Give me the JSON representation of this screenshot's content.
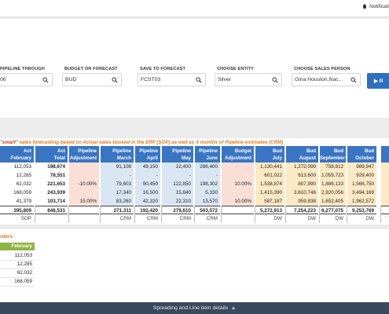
{
  "topbar": {
    "notifications_label": "Notificati"
  },
  "filters": {
    "pipeline_label": "PIPELINE THROUGH",
    "pipeline_value": "06",
    "budget_label": "BUDGET OR FORECAST",
    "budget_value": "BUD",
    "save_label": "SAVE TO FORECAST",
    "save_value": "FCST03",
    "entity_label": "CHOOSE ENTITY",
    "entity_value": "Silver",
    "person_label": "CHOOSE SALES PERSON",
    "person_value": "Gina Houston,Nac...",
    "run_label": "▶ R"
  },
  "section_title": {
    "smart": "\"smart\"",
    "rest": "sales forecasting based on Actual sales booked in the ERP (SOP) as well as X months of Pipeline estimates (CRM)"
  },
  "columns": [
    {
      "h1": "Act",
      "h2": "February"
    },
    {
      "h1": "Act",
      "h2": "Total"
    },
    {
      "h1": "Pipeline",
      "h2": "Adjustment"
    },
    {
      "h1": "Pipeline",
      "h2": "March"
    },
    {
      "h1": "Pipeline",
      "h2": "April"
    },
    {
      "h1": "Pipeline",
      "h2": "May"
    },
    {
      "h1": "Pipeline",
      "h2": "June"
    },
    {
      "h1": "Budget",
      "h2": "Adjustment"
    },
    {
      "h1": "Bud",
      "h2": "July"
    },
    {
      "h1": "Bud",
      "h2": "August"
    },
    {
      "h1": "Bud",
      "h2": "September"
    },
    {
      "h1": "Bud",
      "h2": "October"
    },
    {
      "h1": "No",
      "h2": ""
    }
  ],
  "rows": [
    [
      "112,053",
      "198,674",
      "",
      "91,108",
      "49,150",
      "22,400",
      "286,400",
      "",
      "1,130,441",
      "1,272,099",
      "758,812",
      "989,947",
      "1,4"
    ],
    [
      "12,285",
      "78,551",
      "",
      "-",
      "-",
      "-",
      "-",
      "",
      "601,022",
      "613,600",
      "1,059,723",
      "929,400",
      "1,"
    ],
    [
      "62,032",
      "221,653",
      "-10.00%",
      "79,603",
      "90,450",
      "122,850",
      "198,302",
      "10.00%",
      "1,538,874",
      "807,990",
      "1,886,133",
      "1,566,750",
      "1,"
    ],
    [
      "168,059",
      "243,939",
      "",
      "17,340",
      "16,500",
      "15,840",
      "5,330",
      "",
      "1,415,390",
      "3,610,746",
      "2,920,056",
      "3,494,169",
      "2,"
    ],
    [
      "41,379",
      "103,714",
      "15.00%",
      "83,260",
      "42,320",
      "22,310",
      "13,570",
      "10.00%",
      "587,187",
      "959,838",
      "1,652,405",
      "1,962,572",
      "1,"
    ]
  ],
  "totals": [
    "395,809",
    "846,531",
    "",
    "271,311",
    "192,420",
    "279,610",
    "503,572",
    "",
    "5,272,913",
    "7,254,223",
    "6,277,075",
    "9,253,769",
    "6,"
  ],
  "sources": [
    "SOP",
    "",
    "",
    "CRM",
    "CRM",
    "CRM",
    "CRM",
    "",
    "DW",
    "DW",
    "DW",
    "DW",
    "D"
  ],
  "orders": {
    "title": "rders:",
    "header": "February",
    "values": [
      "112,053",
      "12,285",
      "62,032",
      "168,059"
    ]
  },
  "bottombar": {
    "label": "Spreading and Line item details"
  }
}
